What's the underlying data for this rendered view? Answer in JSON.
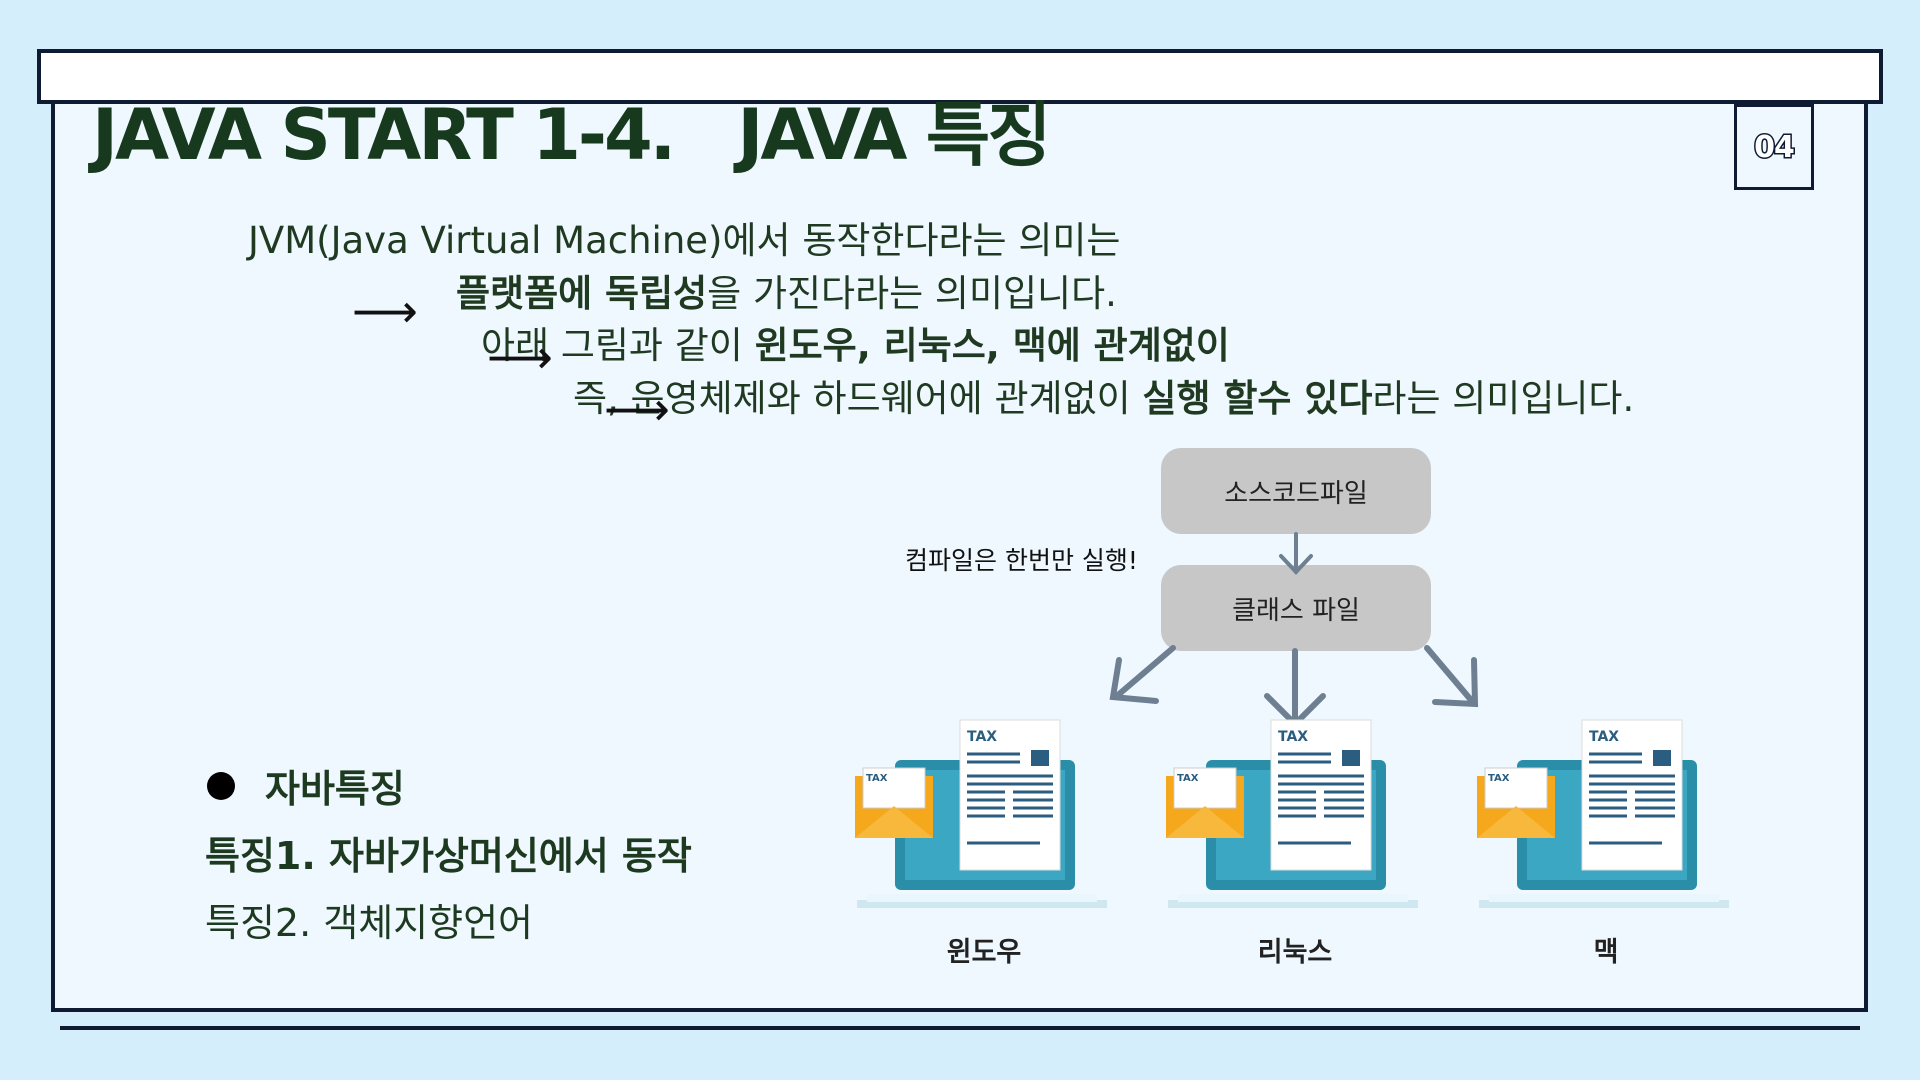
{
  "slide": {
    "title": "JAVA START 1-4.   JAVA 특징",
    "page_number": "04"
  },
  "intro": {
    "line1": "JVM(Java Virtual Machine)에서 동작한다라는 의미는",
    "line2_bold": "플랫폼에 독립성",
    "line2_rest": "을 가진다라는 의미입니다.",
    "line3_plain": "아래 그림과 같이 ",
    "line3_bold": "윈도우, 리눅스, 맥에 관계없이",
    "line4_plain": "즉, 운영체제와 하드웨어에 관계없이 ",
    "line4_bold": "실행 할수 있다",
    "line4_rest": "라는 의미입니다."
  },
  "diagram": {
    "source_box": "소스코드파일",
    "class_box": "클래스 파일",
    "compile_note": "컴파일은 한번만 실행!",
    "platforms": [
      "윈도우",
      "리눅스",
      "맥"
    ],
    "doc_label": "TAX",
    "colors": {
      "box": "#c7c7c7",
      "arrow": "#6f7f92",
      "monitor": "#2b8ea8",
      "envelope": "#f5a81c"
    }
  },
  "features": {
    "title": "자바특징",
    "items": [
      "특징1.  자바가상머신에서 동작",
      "특징2. 객체지향언어"
    ]
  }
}
